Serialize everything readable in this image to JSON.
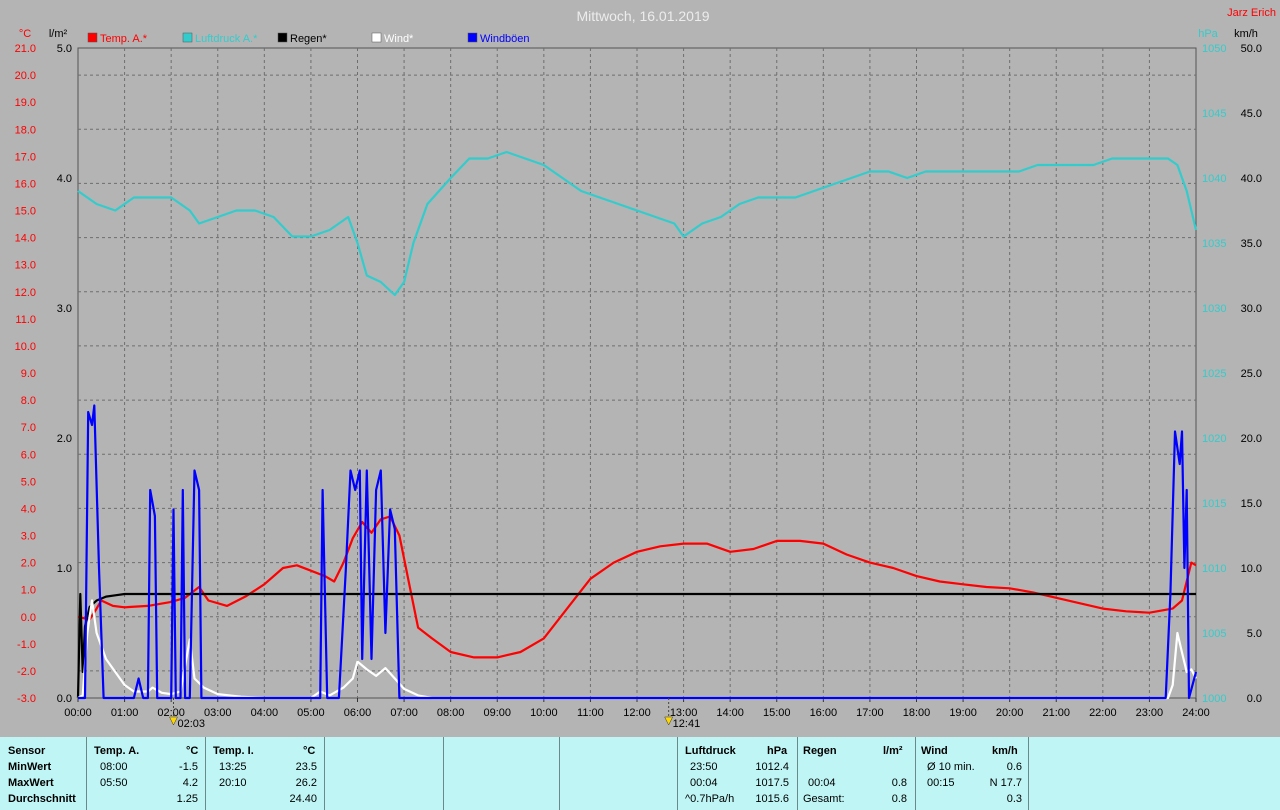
{
  "header": {
    "title": "Mittwoch, 16.01.2019",
    "author": "Jarz Erich"
  },
  "colors": {
    "background": "#b4b4b4",
    "temp": "#ff0000",
    "pressure": "#33cccc",
    "rain": "#000000",
    "wind": "#ffffff",
    "gust": "#0000ff",
    "panel": "#bff5f5"
  },
  "chart_data": {
    "type": "line",
    "legend": [
      {
        "name": "Temp. A.*",
        "color": "#ff0000"
      },
      {
        "name": "Luftdruck A.*",
        "color": "#33cccc"
      },
      {
        "name": "Regen*",
        "color": "#000000"
      },
      {
        "name": "Wind*",
        "color": "#ffffff"
      },
      {
        "name": "Windböen",
        "color": "#0000ff"
      }
    ],
    "axes": {
      "left_temp": {
        "unit": "°C",
        "min": -3,
        "max": 21,
        "step": 1,
        "color": "#ff0000"
      },
      "left_rain": {
        "unit": "l/m²",
        "min": 0,
        "max": 5,
        "step": 1,
        "color": "#000000"
      },
      "right_pressure": {
        "unit": "hPa",
        "min": 1000,
        "max": 1050,
        "color": "#33cccc",
        "ticks": [
          1000,
          1005,
          1010,
          1015,
          1020,
          1025,
          1030,
          1035,
          1040,
          1045,
          1050
        ]
      },
      "right_wind": {
        "unit": "km/h",
        "min": 0,
        "max": 50,
        "step": 5,
        "color": "#000000"
      },
      "x": {
        "min": 0,
        "max": 24,
        "step": 1,
        "labels": [
          "00:00",
          "01:00",
          "02:00",
          "03:00",
          "04:00",
          "05:00",
          "06:00",
          "07:00",
          "08:00",
          "09:00",
          "10:00",
          "11:00",
          "12:00",
          "13:00",
          "14:00",
          "15:00",
          "16:00",
          "17:00",
          "18:00",
          "19:00",
          "20:00",
          "21:00",
          "22:00",
          "23:00",
          "24:00"
        ]
      }
    },
    "grid": true,
    "markers": [
      {
        "time": "02:03",
        "hour": 2.05
      },
      {
        "time": "12:41",
        "hour": 12.68
      }
    ],
    "series": [
      {
        "name": "Temp. A.*",
        "axis": "left_temp",
        "points": [
          [
            0,
            0
          ],
          [
            0.25,
            -0.1
          ],
          [
            0.4,
            0.3
          ],
          [
            0.5,
            0.6
          ],
          [
            0.75,
            0.4
          ],
          [
            1.0,
            0.35
          ],
          [
            1.5,
            0.4
          ],
          [
            2.0,
            0.55
          ],
          [
            2.3,
            0.7
          ],
          [
            2.6,
            1.1
          ],
          [
            2.8,
            0.6
          ],
          [
            3.2,
            0.4
          ],
          [
            3.6,
            0.75
          ],
          [
            4.0,
            1.2
          ],
          [
            4.4,
            1.8
          ],
          [
            4.7,
            1.9
          ],
          [
            5.0,
            1.7
          ],
          [
            5.3,
            1.5
          ],
          [
            5.5,
            1.3
          ],
          [
            5.7,
            2.0
          ],
          [
            5.9,
            2.9
          ],
          [
            6.1,
            3.5
          ],
          [
            6.3,
            3.1
          ],
          [
            6.5,
            3.6
          ],
          [
            6.7,
            3.7
          ],
          [
            6.9,
            3.0
          ],
          [
            7.1,
            1.3
          ],
          [
            7.3,
            -0.4
          ],
          [
            7.6,
            -0.8
          ],
          [
            8.0,
            -1.3
          ],
          [
            8.5,
            -1.5
          ],
          [
            9.0,
            -1.5
          ],
          [
            9.5,
            -1.3
          ],
          [
            10.0,
            -0.8
          ],
          [
            10.5,
            0.3
          ],
          [
            11.0,
            1.4
          ],
          [
            11.5,
            2.0
          ],
          [
            12.0,
            2.4
          ],
          [
            12.5,
            2.6
          ],
          [
            13.0,
            2.7
          ],
          [
            13.5,
            2.7
          ],
          [
            14.0,
            2.4
          ],
          [
            14.5,
            2.5
          ],
          [
            15.0,
            2.8
          ],
          [
            15.5,
            2.8
          ],
          [
            16.0,
            2.7
          ],
          [
            16.5,
            2.3
          ],
          [
            17.0,
            2.0
          ],
          [
            17.5,
            1.8
          ],
          [
            18.0,
            1.5
          ],
          [
            18.5,
            1.3
          ],
          [
            19.0,
            1.2
          ],
          [
            19.5,
            1.1
          ],
          [
            20.0,
            1.05
          ],
          [
            20.5,
            0.9
          ],
          [
            21.0,
            0.7
          ],
          [
            21.5,
            0.5
          ],
          [
            22.0,
            0.3
          ],
          [
            22.5,
            0.2
          ],
          [
            23.0,
            0.15
          ],
          [
            23.5,
            0.3
          ],
          [
            23.7,
            0.6
          ],
          [
            23.9,
            2.0
          ],
          [
            24.0,
            1.9
          ]
        ]
      },
      {
        "name": "Luftdruck A.*",
        "axis": "right_pressure",
        "points": [
          [
            0,
            1039
          ],
          [
            0.4,
            1038
          ],
          [
            0.8,
            1037.5
          ],
          [
            1.2,
            1038.5
          ],
          [
            1.6,
            1038.5
          ],
          [
            2.0,
            1038.5
          ],
          [
            2.4,
            1037.5
          ],
          [
            2.6,
            1036.5
          ],
          [
            3.0,
            1037
          ],
          [
            3.4,
            1037.5
          ],
          [
            3.8,
            1037.5
          ],
          [
            4.2,
            1037
          ],
          [
            4.6,
            1035.5
          ],
          [
            5.0,
            1035.5
          ],
          [
            5.4,
            1036
          ],
          [
            5.8,
            1037
          ],
          [
            6.0,
            1035
          ],
          [
            6.2,
            1032.5
          ],
          [
            6.5,
            1032
          ],
          [
            6.8,
            1031
          ],
          [
            7.0,
            1032
          ],
          [
            7.2,
            1035
          ],
          [
            7.5,
            1038
          ],
          [
            8.0,
            1040
          ],
          [
            8.4,
            1041.5
          ],
          [
            8.8,
            1041.5
          ],
          [
            9.2,
            1042
          ],
          [
            9.6,
            1041.5
          ],
          [
            10.0,
            1041
          ],
          [
            10.4,
            1040
          ],
          [
            10.8,
            1039
          ],
          [
            11.2,
            1038.5
          ],
          [
            11.6,
            1038
          ],
          [
            12.0,
            1037.5
          ],
          [
            12.4,
            1037
          ],
          [
            12.8,
            1036.5
          ],
          [
            13.0,
            1035.5
          ],
          [
            13.4,
            1036.5
          ],
          [
            13.8,
            1037
          ],
          [
            14.2,
            1038
          ],
          [
            14.6,
            1038.5
          ],
          [
            15.0,
            1038.5
          ],
          [
            15.4,
            1038.5
          ],
          [
            15.8,
            1039
          ],
          [
            16.2,
            1039.5
          ],
          [
            16.6,
            1040
          ],
          [
            17.0,
            1040.5
          ],
          [
            17.4,
            1040.5
          ],
          [
            17.8,
            1040
          ],
          [
            18.2,
            1040.5
          ],
          [
            18.6,
            1040.5
          ],
          [
            19.0,
            1040.5
          ],
          [
            19.4,
            1040.5
          ],
          [
            19.8,
            1040.5
          ],
          [
            20.2,
            1040.5
          ],
          [
            20.6,
            1041
          ],
          [
            21.0,
            1041
          ],
          [
            21.4,
            1041
          ],
          [
            21.8,
            1041
          ],
          [
            22.2,
            1041.5
          ],
          [
            22.6,
            1041.5
          ],
          [
            23.0,
            1041.5
          ],
          [
            23.4,
            1041.5
          ],
          [
            23.6,
            1041
          ],
          [
            23.8,
            1039
          ],
          [
            24.0,
            1036
          ]
        ]
      },
      {
        "name": "Regen*",
        "axis": "left_rain",
        "points": [
          [
            0,
            0
          ],
          [
            0.05,
            0.8
          ],
          [
            0.1,
            0.2
          ],
          [
            0.15,
            0.55
          ],
          [
            0.25,
            0.7
          ],
          [
            0.4,
            0.75
          ],
          [
            0.6,
            0.78
          ],
          [
            0.8,
            0.79
          ],
          [
            1.0,
            0.8
          ],
          [
            2.0,
            0.8
          ],
          [
            24.0,
            0.8
          ]
        ]
      },
      {
        "name": "Wind*",
        "axis": "right_wind",
        "points": [
          [
            0,
            0
          ],
          [
            0.1,
            0.2
          ],
          [
            0.2,
            5
          ],
          [
            0.3,
            7.5
          ],
          [
            0.4,
            5
          ],
          [
            0.6,
            3
          ],
          [
            0.8,
            2
          ],
          [
            1.0,
            1
          ],
          [
            1.2,
            0.5
          ],
          [
            1.5,
            0.5
          ],
          [
            1.6,
            0.8
          ],
          [
            1.8,
            0.4
          ],
          [
            2.0,
            0.3
          ],
          [
            2.2,
            0.5
          ],
          [
            2.3,
            2.5
          ],
          [
            2.4,
            4.5
          ],
          [
            2.5,
            1.5
          ],
          [
            2.7,
            0.8
          ],
          [
            3.0,
            0.3
          ],
          [
            3.5,
            0.1
          ],
          [
            4.0,
            0
          ],
          [
            5.0,
            0
          ],
          [
            5.2,
            0.5
          ],
          [
            5.4,
            0.2
          ],
          [
            5.7,
            0.8
          ],
          [
            5.9,
            1.5
          ],
          [
            6.0,
            2.8
          ],
          [
            6.2,
            2.2
          ],
          [
            6.4,
            1.7
          ],
          [
            6.6,
            2.3
          ],
          [
            6.8,
            1.5
          ],
          [
            7.0,
            0.7
          ],
          [
            7.3,
            0.2
          ],
          [
            7.6,
            0
          ],
          [
            23.4,
            0
          ],
          [
            23.5,
            1
          ],
          [
            23.6,
            5
          ],
          [
            23.7,
            3.5
          ],
          [
            23.8,
            2
          ],
          [
            23.9,
            2.2
          ],
          [
            24.0,
            1.5
          ]
        ]
      },
      {
        "name": "Windböen",
        "axis": "right_wind",
        "points": [
          [
            0,
            0
          ],
          [
            0.15,
            0
          ],
          [
            0.22,
            22
          ],
          [
            0.3,
            21
          ],
          [
            0.35,
            22.5
          ],
          [
            0.45,
            10
          ],
          [
            0.55,
            0
          ],
          [
            1.2,
            0
          ],
          [
            1.3,
            1.5
          ],
          [
            1.4,
            0
          ],
          [
            1.5,
            0
          ],
          [
            1.55,
            16
          ],
          [
            1.65,
            14
          ],
          [
            1.7,
            0
          ],
          [
            2.0,
            0
          ],
          [
            2.05,
            14.5
          ],
          [
            2.1,
            0
          ],
          [
            2.2,
            0
          ],
          [
            2.25,
            16
          ],
          [
            2.3,
            0
          ],
          [
            2.4,
            0
          ],
          [
            2.5,
            17.5
          ],
          [
            2.6,
            16
          ],
          [
            2.65,
            0
          ],
          [
            5.2,
            0
          ],
          [
            5.25,
            16
          ],
          [
            5.35,
            0
          ],
          [
            5.6,
            0
          ],
          [
            5.75,
            10
          ],
          [
            5.85,
            17.5
          ],
          [
            5.95,
            16
          ],
          [
            6.05,
            17.5
          ],
          [
            6.1,
            3
          ],
          [
            6.2,
            17.5
          ],
          [
            6.3,
            3
          ],
          [
            6.4,
            16
          ],
          [
            6.5,
            17.5
          ],
          [
            6.6,
            5
          ],
          [
            6.7,
            14.5
          ],
          [
            6.8,
            13
          ],
          [
            6.9,
            0
          ],
          [
            23.35,
            0
          ],
          [
            23.45,
            8
          ],
          [
            23.55,
            20.5
          ],
          [
            23.65,
            18
          ],
          [
            23.7,
            20.5
          ],
          [
            23.75,
            10
          ],
          [
            23.8,
            16
          ],
          [
            23.85,
            0
          ],
          [
            24.0,
            2
          ]
        ]
      }
    ]
  },
  "stats": {
    "row_labels": [
      "Sensor",
      "MinWert",
      "MaxWert",
      "Durchschnitt"
    ],
    "temp_a": {
      "title": "Temp. A.",
      "unit": "°C",
      "min_time": "08:00",
      "min_val": "-1.5",
      "max_time": "05:50",
      "max_val": "4.2",
      "avg": "1.25"
    },
    "temp_i": {
      "title": "Temp. I.",
      "unit": "°C",
      "min_time": "13:25",
      "min_val": "23.5",
      "max_time": "20:10",
      "max_val": "26.2",
      "avg": "24.40"
    },
    "pressure": {
      "title": "Luftdruck",
      "unit": "hPa",
      "min_time": "23:50",
      "min_val": "1012.4",
      "max_time": "00:04",
      "max_val": "1017.5",
      "trend": "^0.7hPa/h",
      "avg": "1015.6"
    },
    "rain": {
      "title": "Regen",
      "unit": "l/m²",
      "max_time": "00:04",
      "max_val": "0.8",
      "total_label": "Gesamt:",
      "total": "0.8"
    },
    "wind": {
      "title": "Wind",
      "unit": "km/h",
      "avg_label": "Ø 10 min.",
      "avg_val": "0.6",
      "max_time": "00:15",
      "max_val": "N 17.7",
      "mean": "0.3"
    }
  }
}
